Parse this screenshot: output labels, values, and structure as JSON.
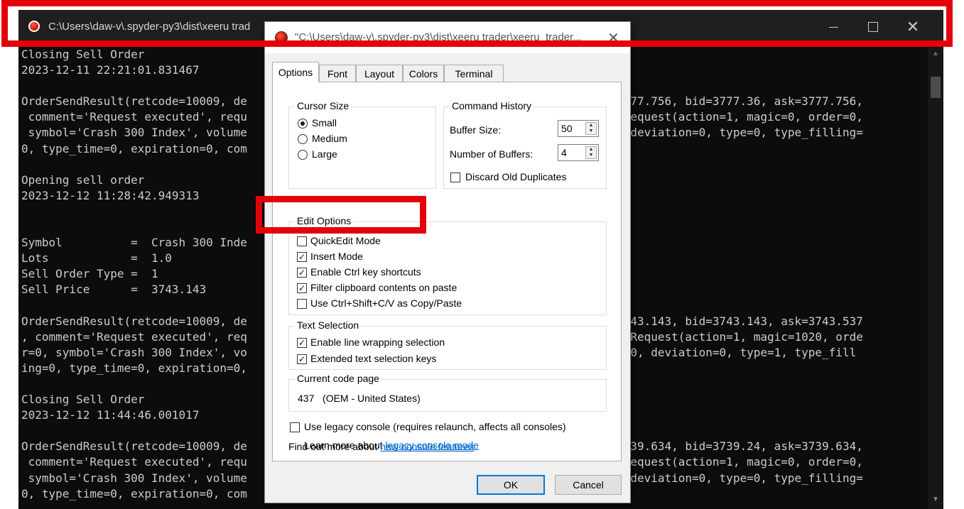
{
  "console": {
    "title": "C:\\Users\\daw-v\\.spyder-py3\\dist\\xeeru trad",
    "lines": [
      "Closing Sell Order",
      "2023-12-11 22:21:01.831467",
      "",
      "OrderSendResult(retcode=10009, de                                                   ce=3777.756, bid=3777.36, ask=3777.756,",
      " comment='Request executed', requ                                                   radeRequest(action=1, magic=0, order=0,",
      " symbol='Crash 300 Index', volume                                                   0.0, deviation=0, type=0, type_filling=",
      "0, type_time=0, expiration=0, com                                                   y=0))",
      "",
      "Opening sell order",
      "2023-12-12 11:28:42.949313",
      "",
      "",
      "Symbol          =  Crash 300 Inde",
      "Lots            =  1.0",
      "Sell Order Type =  1",
      "Sell Price      =  3743.143",
      "",
      "OrderSendResult(retcode=10009, de                                                   ce=3743.143, bid=3743.143, ask=3743.537",
      ", comment='Request executed', req                                                   TradeRequest(action=1, magic=1020, orde",
      "r=0, symbol='Crash 300 Index', vo                                                   tp=0.0, deviation=0, type=1, type_fill",
      "ing=0, type_time=0, expiration=0,",
      "",
      "Closing Sell Order",
      "2023-12-12 11:44:46.001017",
      "",
      "OrderSendResult(retcode=10009, de                                                   ce=3739.634, bid=3739.24, ask=3739.634,",
      " comment='Request executed', requ                                                   radeRequest(action=1, magic=0, order=0,",
      " symbol='Crash 300 Index', volume                                                   0.0, deviation=0, type=0, type_filling=",
      "0, type_time=0, expiration=0, com                                                   y=0))"
    ]
  },
  "dialog": {
    "title": "\"C:\\Users\\daw-v\\.spyder-py3\\dist\\xeeru trader\\xeeru_trader...",
    "tabs": [
      "Options",
      "Font",
      "Layout",
      "Colors",
      "Terminal"
    ],
    "active_tab": "Options",
    "cursor_size": {
      "label": "Cursor Size",
      "options": [
        "Small",
        "Medium",
        "Large"
      ],
      "selected": "Small"
    },
    "command_history": {
      "label": "Command History",
      "buffer_size_label": "Buffer Size:",
      "buffer_size": "50",
      "num_buffers_label": "Number of Buffers:",
      "num_buffers": "4",
      "discard_label": "Discard Old Duplicates",
      "discard_checked": false
    },
    "edit_options": {
      "label": "Edit Options",
      "quickedit_label": "QuickEdit Mode",
      "quickedit_checked": false,
      "insert_label": "Insert Mode",
      "insert_checked": true,
      "ctrl_label": "Enable Ctrl key shortcuts",
      "ctrl_checked": true,
      "filter_label": "Filter clipboard contents on paste",
      "filter_checked": true,
      "shift_label": "Use Ctrl+Shift+C/V as Copy/Paste",
      "shift_checked": false
    },
    "text_selection": {
      "label": "Text Selection",
      "wrap_label": "Enable line wrapping selection",
      "wrap_checked": true,
      "extended_label": "Extended text selection keys",
      "extended_checked": true
    },
    "code_page": {
      "label": "Current code page",
      "value": "437   (OEM - United States)"
    },
    "legacy": {
      "label": "Use legacy console (requires relaunch, affects all consoles)",
      "checked": false,
      "learn_prefix": "Learn more about ",
      "learn_link": "legacy console mode"
    },
    "features": {
      "prefix": "Find out more about ",
      "link": "new console features"
    },
    "ok_label": "OK",
    "cancel_label": "Cancel"
  },
  "colors": {
    "annotation": "#e3000b",
    "console_bg": "#0c0c0c",
    "console_text": "#cccccc",
    "link": "#0066cc"
  }
}
